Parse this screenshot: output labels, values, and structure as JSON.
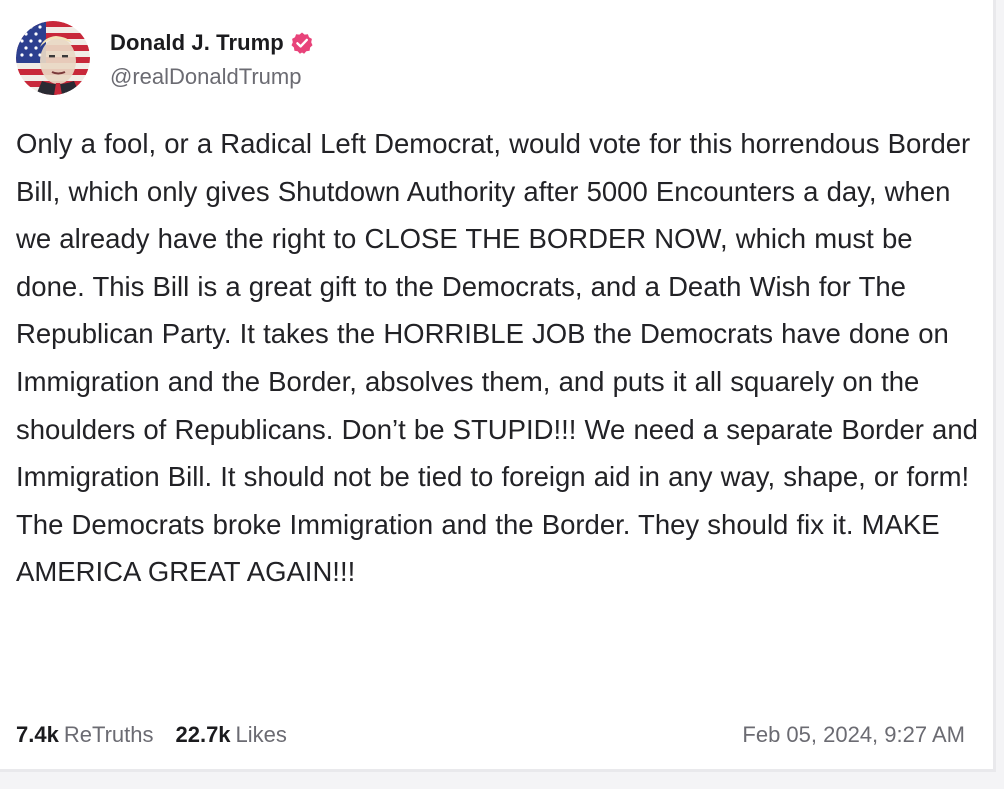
{
  "post": {
    "author": {
      "display_name": "Donald J. Trump",
      "handle": "@realDonaldTrump",
      "verified_icon": "verified-badge-icon",
      "avatar_icon": "avatar"
    },
    "text": "Only a fool, or a Radical Left Democrat, would vote for this horrendous Border Bill, which only gives Shutdown Authority after 5000 Encounters a day, when we already have the right to CLOSE THE BORDER NOW, which must be done. This Bill is a great gift to the Democrats, and a Death Wish for The Republican Party. It takes the HORRIBLE JOB the Democrats have done on Immigration and the Border, absolves them, and puts it all squarely on the shoulders of Republicans. Don’t be STUPID!!! We need a separate Border and Immigration Bill. It should not be tied to foreign aid in any way, shape, or form! The Democrats broke Immigration and the Border. They should fix it. MAKE AMERICA GREAT AGAIN!!!",
    "stats": {
      "retruths_count": "7.4k",
      "retruths_label": "ReTruths",
      "likes_count": "22.7k",
      "likes_label": "Likes"
    },
    "timestamp": "Feb 05, 2024, 9:27 AM"
  },
  "colors": {
    "verified_badge": "#e8437a",
    "primary_text": "#1b1b1e",
    "secondary_text": "#6b6b72",
    "background": "#ffffff"
  }
}
